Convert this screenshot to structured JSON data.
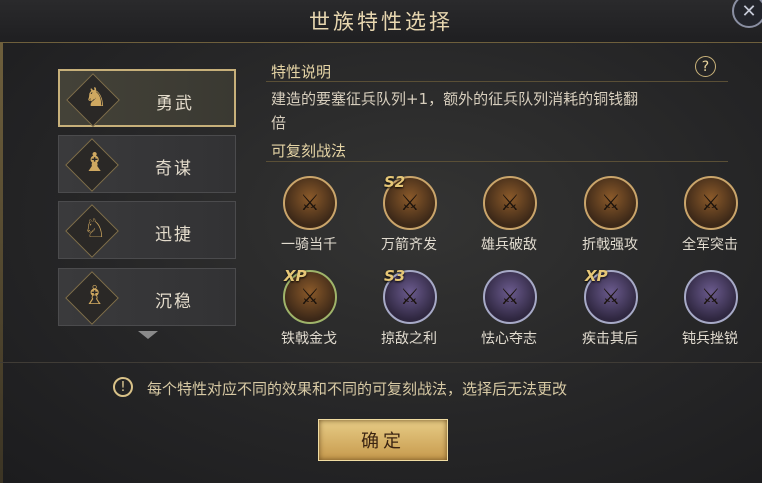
{
  "window": {
    "title": "世族特性选择",
    "close_glyph": "✕"
  },
  "traits": [
    {
      "label": "勇武",
      "selected": true,
      "icon": "warrior-icon"
    },
    {
      "label": "奇谋",
      "selected": false,
      "icon": "strategist-icon"
    },
    {
      "label": "迅捷",
      "selected": false,
      "icon": "cavalry-icon"
    },
    {
      "label": "沉稳",
      "selected": false,
      "icon": "sage-icon"
    }
  ],
  "description": {
    "title": "特性说明",
    "line1": "建造的要塞征兵队列+1，额外的征兵队列消耗的铜钱翻",
    "line2": "倍",
    "help_glyph": "?"
  },
  "skills": {
    "title": "可复刻战法",
    "row1": [
      {
        "label": "一骑当千",
        "badge": "",
        "style": "bronze"
      },
      {
        "label": "万箭齐发",
        "badge": "S2",
        "style": "bronze"
      },
      {
        "label": "雄兵破敌",
        "badge": "",
        "style": "bronze"
      },
      {
        "label": "折戟强攻",
        "badge": "",
        "style": "bronze"
      },
      {
        "label": "全军突击",
        "badge": "",
        "style": "bronze"
      }
    ],
    "row2": [
      {
        "label": "铁戟金戈",
        "badge": "XP",
        "style": "bronze"
      },
      {
        "label": "掠敌之利",
        "badge": "S3",
        "style": "purple"
      },
      {
        "label": "怯心夺志",
        "badge": "",
        "style": "purple"
      },
      {
        "label": "疾击其后",
        "badge": "XP",
        "style": "purple"
      },
      {
        "label": "钝兵挫锐",
        "badge": "",
        "style": "purple"
      }
    ]
  },
  "notice": {
    "icon_glyph": "!",
    "text": "每个特性对应不同的效果和不同的可复刻战法，选择后无法更改"
  },
  "confirm_label": "确定",
  "colors": {
    "accent_gold": "#c7b07a",
    "button_gold": "#d9b56a",
    "text_light": "#e4dccc"
  }
}
